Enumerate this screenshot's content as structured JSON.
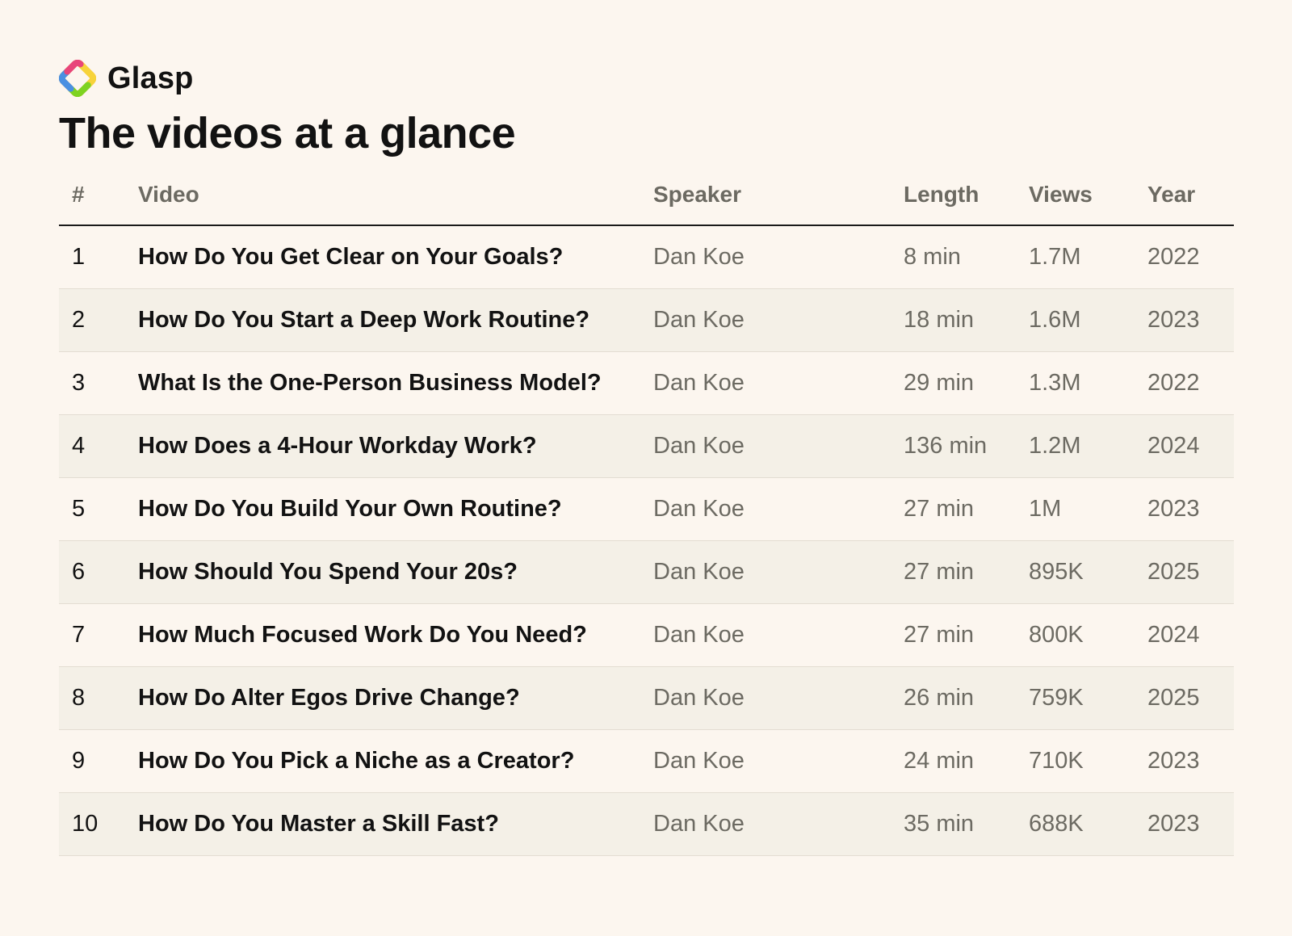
{
  "brand": {
    "name": "Glasp",
    "logo_icon": "glasp-logo-icon",
    "logo_colors": [
      "#F5A623",
      "#7ED321",
      "#4A90E2",
      "#E8457A"
    ]
  },
  "title": "The videos at a glance",
  "table": {
    "headers": {
      "num": "#",
      "video": "Video",
      "speaker": "Speaker",
      "length": "Length",
      "views": "Views",
      "year": "Year"
    },
    "rows": [
      {
        "num": "1",
        "video": "How Do You Get Clear on Your Goals?",
        "speaker": "Dan Koe",
        "length": "8 min",
        "views": "1.7M",
        "year": "2022"
      },
      {
        "num": "2",
        "video": "How Do You Start a Deep Work Routine?",
        "speaker": "Dan Koe",
        "length": "18 min",
        "views": "1.6M",
        "year": "2023"
      },
      {
        "num": "3",
        "video": "What Is the One-Person Business Model?",
        "speaker": "Dan Koe",
        "length": "29 min",
        "views": "1.3M",
        "year": "2022"
      },
      {
        "num": "4",
        "video": "How Does a 4-Hour Workday Work?",
        "speaker": "Dan Koe",
        "length": "136 min",
        "views": "1.2M",
        "year": "2024"
      },
      {
        "num": "5",
        "video": "How Do You Build Your Own Routine?",
        "speaker": "Dan Koe",
        "length": "27 min",
        "views": "1M",
        "year": "2023"
      },
      {
        "num": "6",
        "video": "How Should You Spend Your 20s?",
        "speaker": "Dan Koe",
        "length": "27 min",
        "views": "895K",
        "year": "2025"
      },
      {
        "num": "7",
        "video": "How Much Focused Work Do You Need?",
        "speaker": "Dan Koe",
        "length": "27 min",
        "views": "800K",
        "year": "2024"
      },
      {
        "num": "8",
        "video": "How Do Alter Egos Drive Change?",
        "speaker": "Dan Koe",
        "length": "26 min",
        "views": "759K",
        "year": "2025"
      },
      {
        "num": "9",
        "video": "How Do You Pick a Niche as a Creator?",
        "speaker": "Dan Koe",
        "length": "24 min",
        "views": "710K",
        "year": "2023"
      },
      {
        "num": "10",
        "video": "How Do You Master a Skill Fast?",
        "speaker": "Dan Koe",
        "length": "35 min",
        "views": "688K",
        "year": "2023"
      }
    ]
  }
}
